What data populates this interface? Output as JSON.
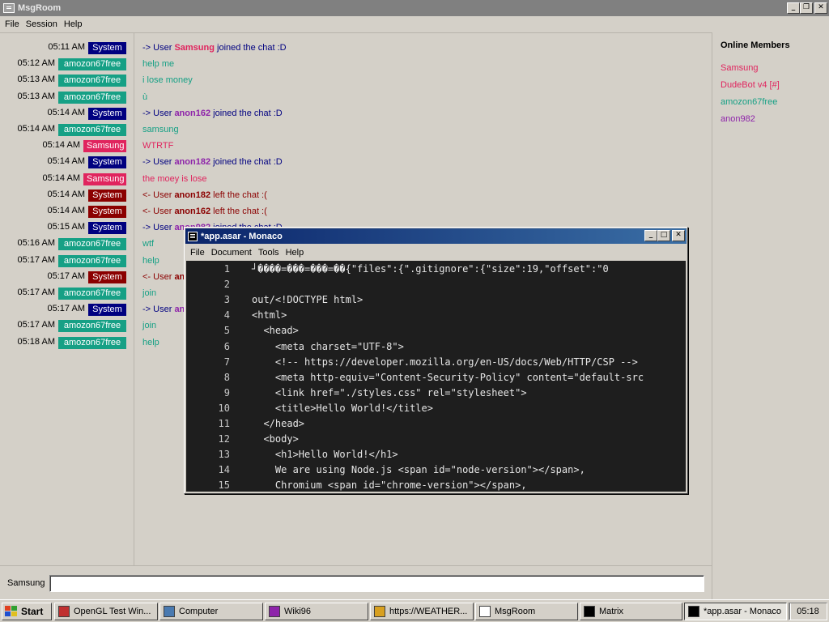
{
  "msgroom": {
    "title": "MsgRoom",
    "menu": [
      "File",
      "Session",
      "Help"
    ],
    "messages": [
      {
        "time": "05:11 AM",
        "user": "System",
        "badge_color": "#000080",
        "parts": [
          {
            "t": "-> User ",
            "c": "#000080"
          },
          {
            "t": "Samsung",
            "c": "#e0245e",
            "b": true
          },
          {
            "t": " joined the chat :D",
            "c": "#000080"
          }
        ]
      },
      {
        "time": "05:12 AM",
        "user": "amozon67free",
        "badge_color": "#16a085",
        "parts": [
          {
            "t": "help me",
            "c": "#16a085"
          }
        ]
      },
      {
        "time": "05:13 AM",
        "user": "amozon67free",
        "badge_color": "#16a085",
        "parts": [
          {
            "t": "i lose money",
            "c": "#16a085"
          }
        ]
      },
      {
        "time": "05:13 AM",
        "user": "amozon67free",
        "badge_color": "#16a085",
        "parts": [
          {
            "t": "ù",
            "c": "#16a085"
          }
        ]
      },
      {
        "time": "05:14 AM",
        "user": "System",
        "badge_color": "#000080",
        "parts": [
          {
            "t": "-> User ",
            "c": "#000080"
          },
          {
            "t": "anon162",
            "c": "#8e24aa",
            "b": true
          },
          {
            "t": " joined the chat :D",
            "c": "#000080"
          }
        ]
      },
      {
        "time": "05:14 AM",
        "user": "amozon67free",
        "badge_color": "#16a085",
        "parts": [
          {
            "t": "samsung",
            "c": "#16a085"
          }
        ]
      },
      {
        "time": "05:14 AM",
        "user": "Samsung",
        "badge_color": "#e0245e",
        "parts": [
          {
            "t": "WTRTF",
            "c": "#e0245e"
          }
        ]
      },
      {
        "time": "05:14 AM",
        "user": "System",
        "badge_color": "#000080",
        "parts": [
          {
            "t": "-> User ",
            "c": "#000080"
          },
          {
            "t": "anon182",
            "c": "#8e24aa",
            "b": true
          },
          {
            "t": " joined the chat :D",
            "c": "#000080"
          }
        ]
      },
      {
        "time": "05:14 AM",
        "user": "Samsung",
        "badge_color": "#e0245e",
        "parts": [
          {
            "t": "the moey is lose",
            "c": "#e0245e"
          }
        ]
      },
      {
        "time": "05:14 AM",
        "user": "System",
        "badge_color": "#8b0000",
        "parts": [
          {
            "t": "<- User ",
            "c": "#8b0000"
          },
          {
            "t": "anon182",
            "c": "#8b0000",
            "b": true
          },
          {
            "t": " left the chat :(",
            "c": "#8b0000"
          }
        ]
      },
      {
        "time": "05:14 AM",
        "user": "System",
        "badge_color": "#8b0000",
        "parts": [
          {
            "t": "<- User ",
            "c": "#8b0000"
          },
          {
            "t": "anon162",
            "c": "#8b0000",
            "b": true
          },
          {
            "t": " left the chat :(",
            "c": "#8b0000"
          }
        ]
      },
      {
        "time": "05:15 AM",
        "user": "System",
        "badge_color": "#000080",
        "parts": [
          {
            "t": "-> User ",
            "c": "#000080"
          },
          {
            "t": "anon982",
            "c": "#8e24aa",
            "b": true
          },
          {
            "t": " joined the chat :D",
            "c": "#000080"
          }
        ]
      },
      {
        "time": "05:16 AM",
        "user": "amozon67free",
        "badge_color": "#16a085",
        "parts": [
          {
            "t": "wtf",
            "c": "#16a085"
          }
        ]
      },
      {
        "time": "05:17 AM",
        "user": "amozon67free",
        "badge_color": "#16a085",
        "parts": [
          {
            "t": "help",
            "c": "#16a085"
          }
        ]
      },
      {
        "time": "05:17 AM",
        "user": "System",
        "badge_color": "#8b0000",
        "parts": [
          {
            "t": "<- User ",
            "c": "#8b0000"
          },
          {
            "t": "anon982",
            "c": "#8b0000",
            "b": true
          },
          {
            "t": " left the chat :(",
            "c": "#8b0000"
          }
        ]
      },
      {
        "time": "05:17 AM",
        "user": "amozon67free",
        "badge_color": "#16a085",
        "parts": [
          {
            "t": "join",
            "c": "#16a085"
          }
        ]
      },
      {
        "time": "05:17 AM",
        "user": "System",
        "badge_color": "#000080",
        "parts": [
          {
            "t": "-> User ",
            "c": "#000080"
          },
          {
            "t": "anon982",
            "c": "#8e24aa",
            "b": true
          },
          {
            "t": " joined the chat :D",
            "c": "#000080"
          }
        ]
      },
      {
        "time": "05:17 AM",
        "user": "amozon67free",
        "badge_color": "#16a085",
        "parts": [
          {
            "t": "join",
            "c": "#16a085"
          }
        ]
      },
      {
        "time": "05:18 AM",
        "user": "amozon67free",
        "badge_color": "#16a085",
        "parts": [
          {
            "t": "help",
            "c": "#16a085"
          }
        ]
      }
    ],
    "members_heading": "Online Members",
    "members": [
      {
        "name": "Samsung",
        "color": "#e0245e"
      },
      {
        "name": "DudeBot v4 [#]",
        "color": "#e0245e"
      },
      {
        "name": "amozon67free",
        "color": "#16a085"
      },
      {
        "name": "anon982",
        "color": "#8e24aa"
      }
    ],
    "input_label": "Samsung",
    "input_value": ""
  },
  "monaco": {
    "title": "*app.asar - Monaco",
    "menu": [
      "File",
      "Document",
      "Tools",
      "Help"
    ],
    "lines": [
      {
        "n": "1",
        "text": "┘����=���=���=��{\"files\":{\".gitignore\":{\"size\":19,\"offset\":\"0"
      },
      {
        "n": "2",
        "text": ""
      },
      {
        "n": "3",
        "text": "out/<!DOCTYPE html>"
      },
      {
        "n": "4",
        "text": "<html>"
      },
      {
        "n": "5",
        "text": "  <head>"
      },
      {
        "n": "6",
        "text": "    <meta charset=\"UTF-8\">"
      },
      {
        "n": "7",
        "text": "    <!-- https://developer.mozilla.org/en-US/docs/Web/HTTP/CSP -->"
      },
      {
        "n": "8",
        "text": "    <meta http-equiv=\"Content-Security-Policy\" content=\"default-src"
      },
      {
        "n": "9",
        "text": "    <link href=\"./styles.css\" rel=\"stylesheet\">"
      },
      {
        "n": "10",
        "text": "    <title>Hello World!</title>"
      },
      {
        "n": "11",
        "text": "  </head>"
      },
      {
        "n": "12",
        "text": "  <body>"
      },
      {
        "n": "13",
        "text": "    <h1>Hello World!</h1>"
      },
      {
        "n": "14",
        "text": "    We are using Node.js <span id=\"node-version\"></span>,"
      },
      {
        "n": "15",
        "text": "    Chromium <span id=\"chrome-version\"></span>,"
      }
    ]
  },
  "taskbar": {
    "start_label": "Start",
    "tasks": [
      {
        "label": "OpenGL Test Win...",
        "icon": "opengl-icon",
        "color": "#c03030",
        "active": false
      },
      {
        "label": "Computer",
        "icon": "computer-icon",
        "color": "#4a7ab0",
        "active": false
      },
      {
        "label": "Wiki96",
        "icon": "wiki-book-icon",
        "color": "#8e24aa",
        "active": false
      },
      {
        "label": "https://WEATHER...",
        "icon": "browser-icon",
        "color": "#d8a020",
        "active": false
      },
      {
        "label": "MsgRoom",
        "icon": "chat-icon",
        "color": "#ffffff",
        "active": false
      },
      {
        "label": "Matrix",
        "icon": "terminal-icon",
        "color": "#000000",
        "active": false
      },
      {
        "label": "*app.asar - Monaco",
        "icon": "editor-icon",
        "color": "#000000",
        "active": true
      }
    ],
    "clock": "05:18"
  }
}
